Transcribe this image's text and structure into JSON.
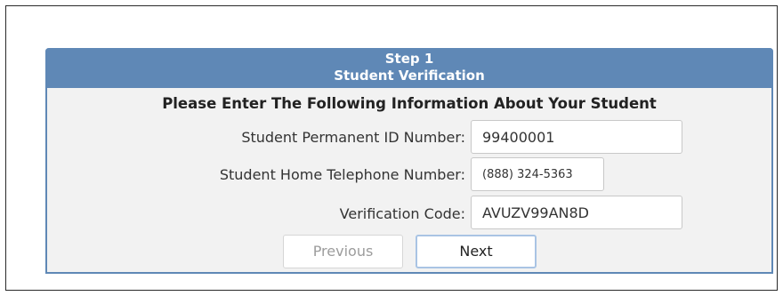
{
  "panel": {
    "step_label": "Step 1",
    "step_title": "Student Verification",
    "instructions": "Please Enter The Following Information About Your Student"
  },
  "fields": {
    "student_id": {
      "label": "Student Permanent ID Number:",
      "value": "99400001"
    },
    "home_phone": {
      "label": "Student Home Telephone Number:",
      "value": "(888) 324-5363"
    },
    "verification_code": {
      "label": "Verification Code:",
      "value": "AVUZV99AN8D"
    }
  },
  "buttons": {
    "previous": "Previous",
    "next": "Next"
  },
  "colors": {
    "header_bg": "#5f88b6",
    "panel_bg": "#f2f2f2",
    "next_border": "#a9c4e4"
  }
}
